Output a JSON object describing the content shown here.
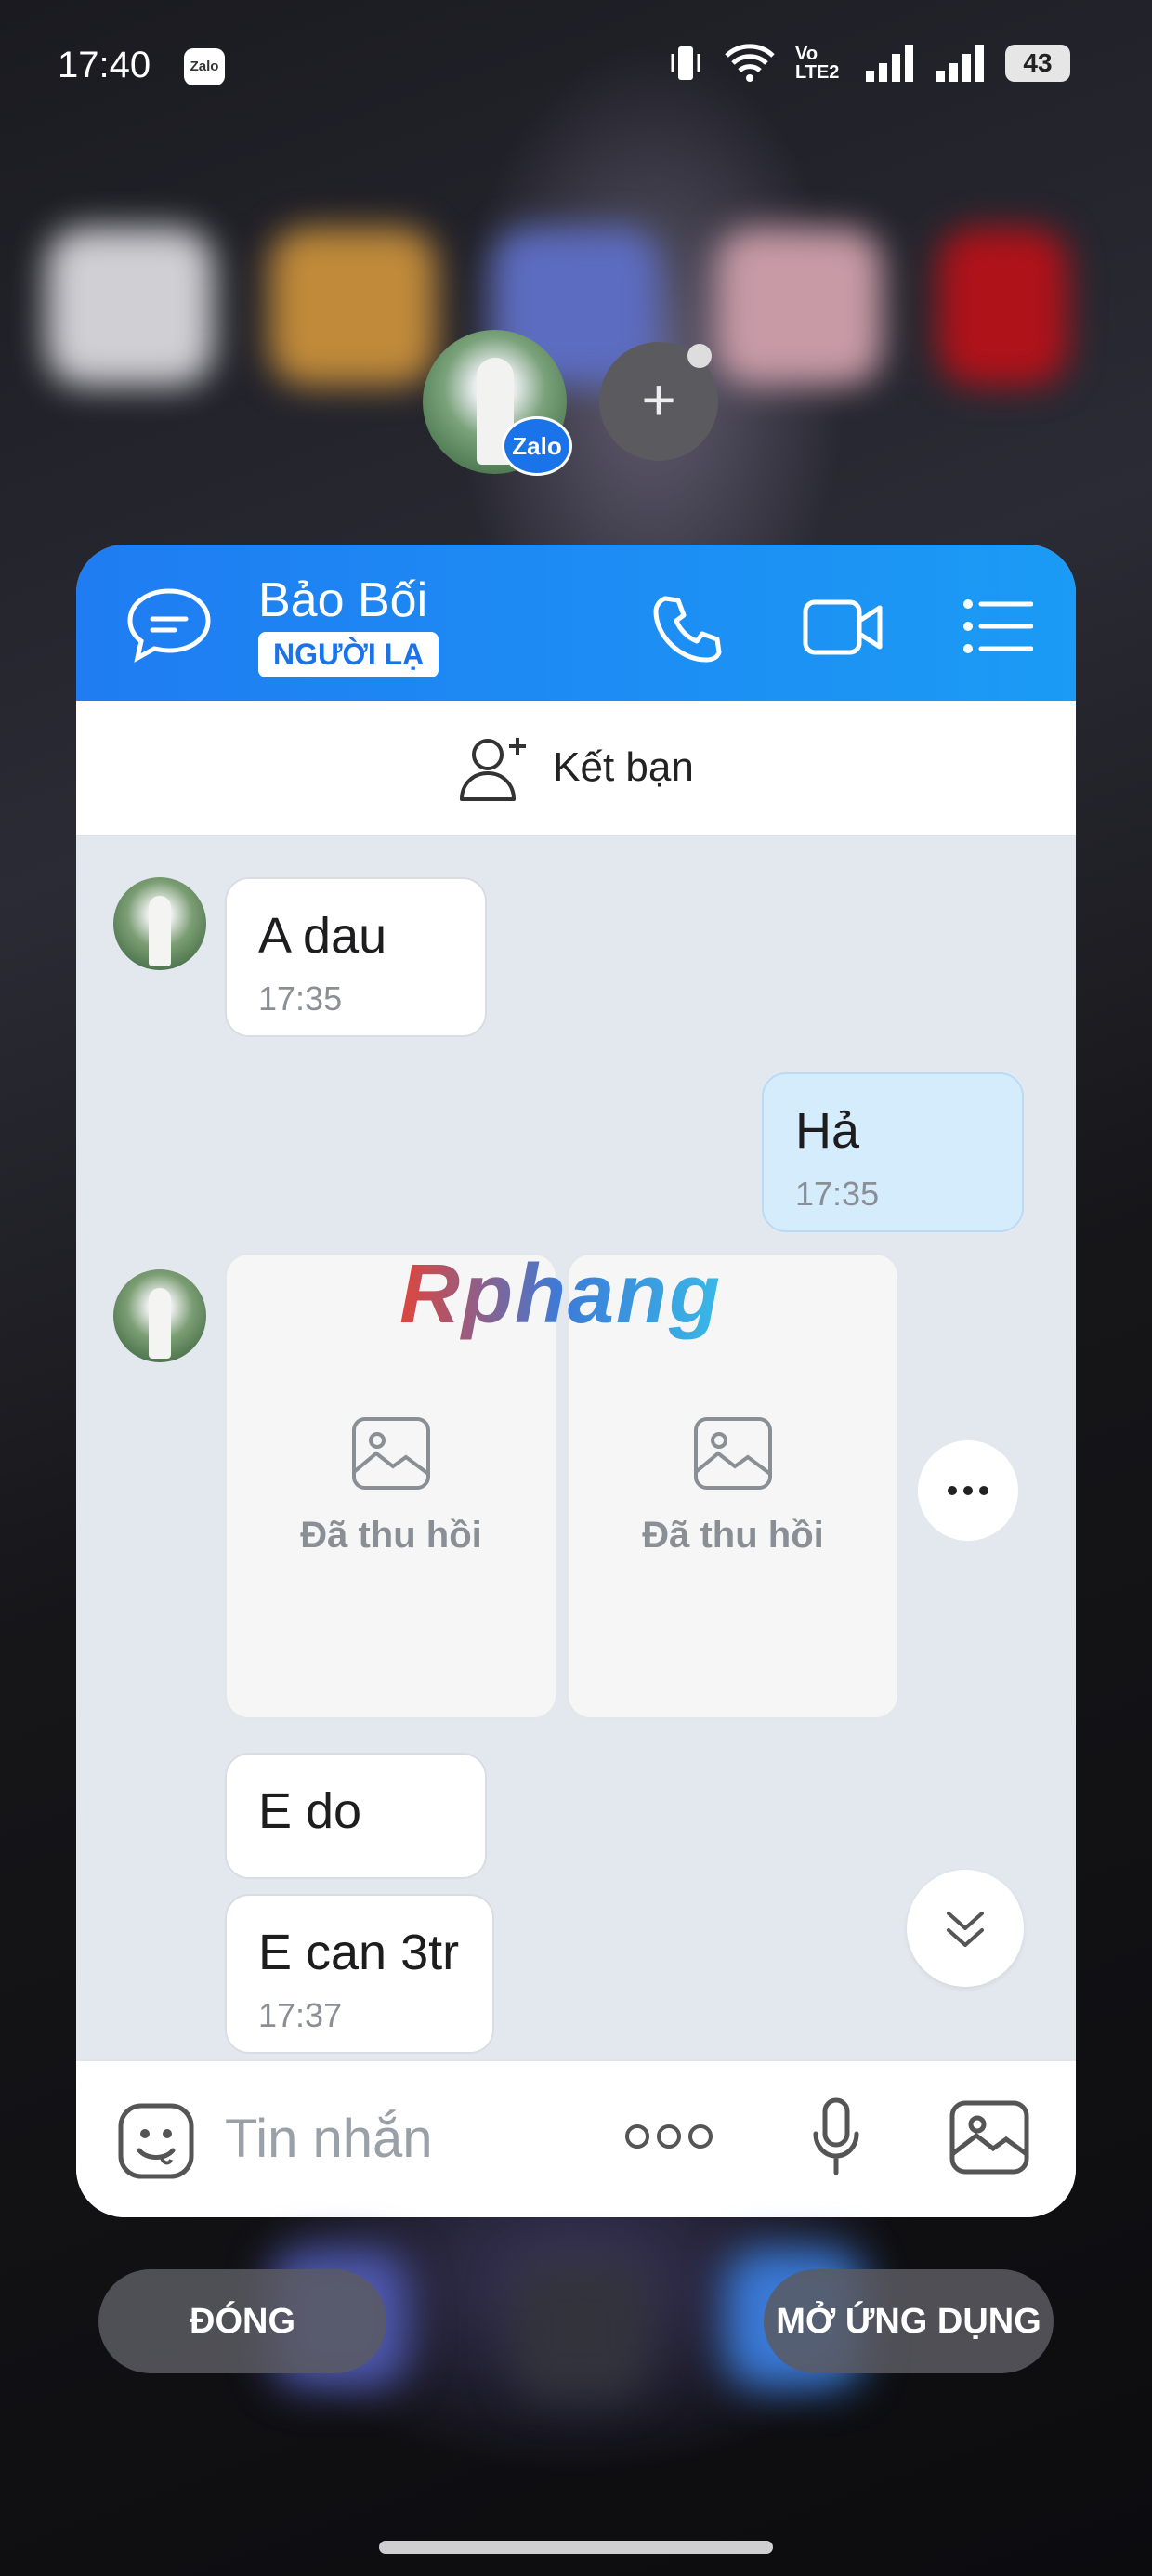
{
  "status_bar": {
    "time": "17:40",
    "app_badge": "Zalo",
    "network_label": "Vo LTE2",
    "battery": "43"
  },
  "floating": {
    "badge": "Zalo",
    "add_symbol": "+"
  },
  "chat": {
    "contact_name": "Bảo Bối",
    "tag": "NGƯỜI LẠ",
    "add_friend_label": "Kết bạn",
    "messages": [
      {
        "direction": "in",
        "text": "A dau",
        "time": "17:35"
      },
      {
        "direction": "out",
        "text": "Hả",
        "time": "17:35"
      },
      {
        "direction": "in",
        "type": "recalled_photos",
        "items": [
          "Đã thu hồi",
          "Đã thu hồi"
        ]
      },
      {
        "direction": "in",
        "text": "E do"
      },
      {
        "direction": "in",
        "text": "E can 3tr",
        "time": "17:37"
      }
    ],
    "watermark": "Rphang",
    "composer_placeholder": "Tin nhắn"
  },
  "actions": {
    "close": "ĐÓNG",
    "open_app": "MỞ ỨNG DỤNG"
  },
  "colors": {
    "header_start": "#1f7cf2",
    "header_end": "#1b9bf5",
    "outgoing_bubble": "#d5ecfd",
    "chat_bg": "#e3e8ef"
  },
  "icons": [
    "chat-bubble-icon",
    "phone-icon",
    "video-call-icon",
    "menu-list-icon",
    "add-friend-icon",
    "image-icon",
    "more-dots-icon",
    "chevron-double-down-icon",
    "sticker-icon",
    "microphone-icon",
    "gallery-icon"
  ]
}
